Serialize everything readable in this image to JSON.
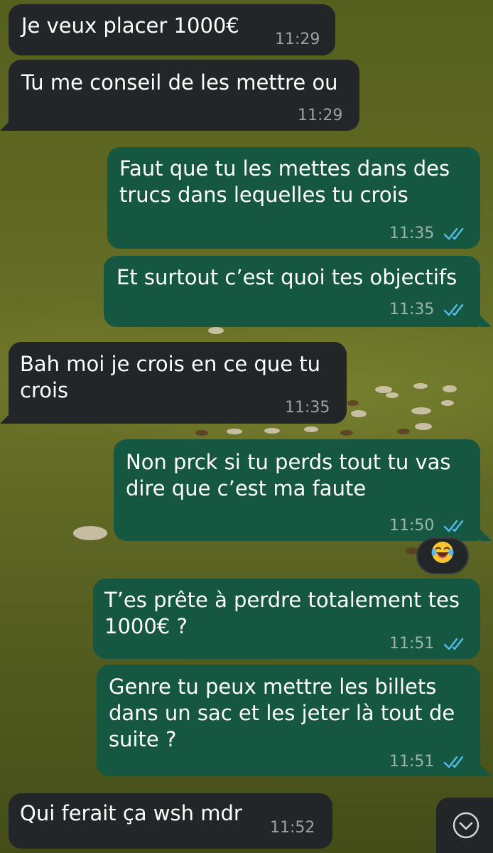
{
  "messages": [
    {
      "text": "Je veux placer 1000€",
      "time": "11:29",
      "direction": "incoming"
    },
    {
      "text": "Tu me conseil de les mettre ou",
      "time": "11:29",
      "direction": "incoming"
    },
    {
      "text": "Faut que tu les mettes dans des\ntrucs dans lequelles tu crois",
      "time": "11:35",
      "direction": "outgoing",
      "status": "read"
    },
    {
      "text": "Et surtout c’est quoi tes objectifs",
      "time": "11:35",
      "direction": "outgoing",
      "status": "read"
    },
    {
      "text": "Bah moi je crois en ce que tu\ncrois",
      "time": "11:35",
      "direction": "incoming"
    },
    {
      "text": "Non prck si tu perds tout tu vas\ndire que c’est ma faute",
      "time": "11:50",
      "direction": "outgoing",
      "status": "read",
      "reaction": "😂"
    },
    {
      "text": "T’es prête à perdre totalement tes\n1000€ ?",
      "time": "11:51",
      "direction": "outgoing",
      "status": "read"
    },
    {
      "text": "Genre tu peux mettre les billets\ndans un sac et les jeter là tout de\nsuite ?",
      "time": "11:51",
      "direction": "outgoing",
      "status": "read"
    },
    {
      "text": "Qui ferait ça wsh mdr",
      "time": "11:52",
      "direction": "incoming"
    }
  ],
  "icons": {
    "read_receipt": "double-check-icon",
    "scroll_down": "chevron-down-circle-icon",
    "reaction": "laughing-tears-emoji"
  },
  "colors": {
    "incoming_bubble": "#232628",
    "outgoing_bubble": "#165742",
    "read_ticks": "#53bdeb",
    "wallpaper": "#5d6722"
  }
}
